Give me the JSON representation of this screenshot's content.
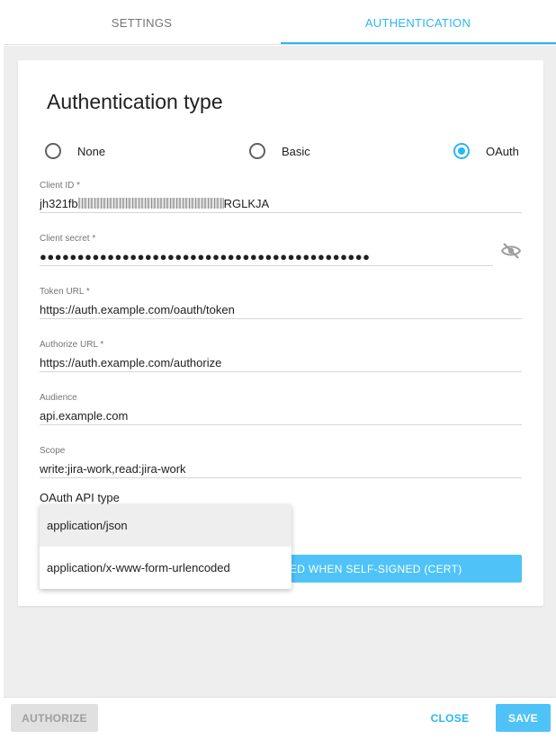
{
  "tabs": [
    {
      "label": "SETTINGS",
      "active": false
    },
    {
      "label": "AUTHENTICATION",
      "active": true
    }
  ],
  "auth": {
    "title": "Authentication type",
    "options": [
      {
        "label": "None",
        "checked": false
      },
      {
        "label": "Basic",
        "checked": false
      },
      {
        "label": "OAuth",
        "checked": true
      }
    ]
  },
  "fields": {
    "client_id": {
      "label": "Client ID *",
      "value_prefix": "jh321fb",
      "value_suffix": "RGLKJA"
    },
    "client_secret": {
      "label": "Client secret *",
      "value": "●●●●●●●●●●●●●●●●●●●●●●●●●●●●●●●●●●●●●●●●●●●●",
      "visibility_icon": "eye-off-icon"
    },
    "token_url": {
      "label": "Token URL *",
      "value": "https://auth.example.com/oauth/token"
    },
    "authorize_url": {
      "label": "Authorize URL *",
      "value": "https://auth.example.com/authorize"
    },
    "audience": {
      "label": "Audience",
      "value": "api.example.com"
    },
    "scope": {
      "label": "Scope",
      "value": "write:jira-work,read:jira-work"
    }
  },
  "oauth_api_type": {
    "label": "OAuth API type",
    "options": [
      "application/json",
      "application/x-www-form-urlencoded"
    ],
    "highlighted": "application/json"
  },
  "cert_button": {
    "label": "ED WHEN SELF-SIGNED (CERT)"
  },
  "footer": {
    "authorize_label": "AUTHORIZE",
    "close_label": "CLOSE",
    "save_label": "SAVE"
  },
  "colors": {
    "accent": "#29b6f6",
    "button_fill": "#4fc3f7",
    "background": "#eeeeee"
  }
}
